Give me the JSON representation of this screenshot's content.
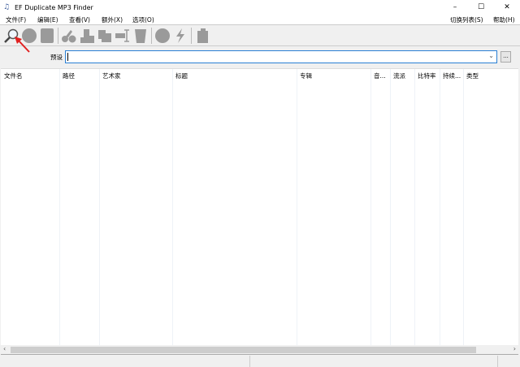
{
  "window": {
    "title": "EF Duplicate MP3 Finder",
    "minimize": "–",
    "maximize": "☐",
    "close": "✕"
  },
  "menu": [
    "文件(F)",
    "编辑(E)",
    "查看(V)",
    "额外(X)",
    "选项(O)"
  ],
  "menu_right": [
    "切换列表(S)",
    "帮助(H)"
  ],
  "toolbar": {
    "icons": [
      "search-icon",
      "circle-icon",
      "document-icon",
      "cut-icon",
      "copy-icon",
      "paste-icon",
      "rename-icon",
      "trash-icon",
      "stop-icon",
      "flash-icon",
      "tag-icon"
    ]
  },
  "preset": {
    "label": "预设",
    "value": "",
    "more_label": "..."
  },
  "columns": [
    "文件名",
    "路径",
    "艺术家",
    "标题",
    "专辑",
    "音...",
    "流派",
    "比特率",
    "持续...",
    "类型"
  ],
  "colors": {
    "accent": "#2a7fd4",
    "arrow": "#e02020"
  }
}
